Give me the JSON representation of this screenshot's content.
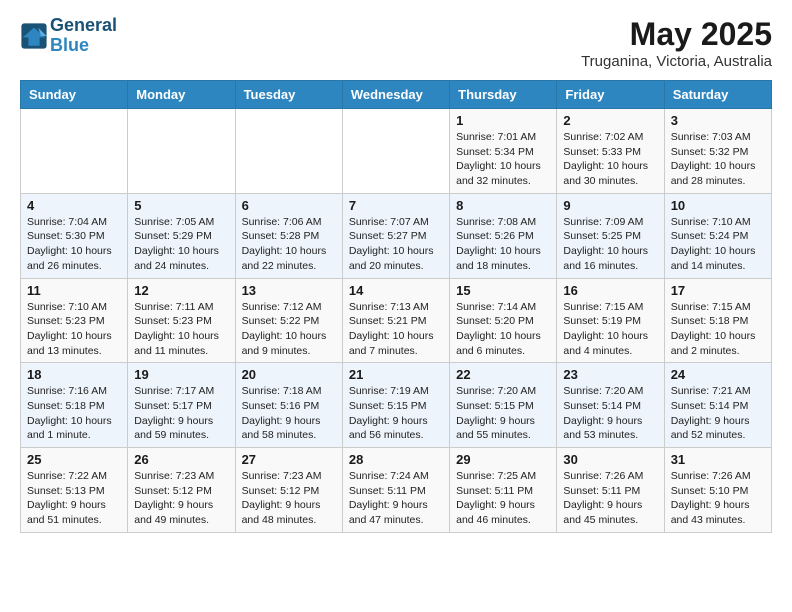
{
  "header": {
    "logo_line1": "General",
    "logo_line2": "Blue",
    "title": "May 2025",
    "subtitle": "Truganina, Victoria, Australia"
  },
  "days_of_week": [
    "Sunday",
    "Monday",
    "Tuesday",
    "Wednesday",
    "Thursday",
    "Friday",
    "Saturday"
  ],
  "weeks": [
    [
      {
        "day": "",
        "text": ""
      },
      {
        "day": "",
        "text": ""
      },
      {
        "day": "",
        "text": ""
      },
      {
        "day": "",
        "text": ""
      },
      {
        "day": "1",
        "text": "Sunrise: 7:01 AM\nSunset: 5:34 PM\nDaylight: 10 hours\nand 32 minutes."
      },
      {
        "day": "2",
        "text": "Sunrise: 7:02 AM\nSunset: 5:33 PM\nDaylight: 10 hours\nand 30 minutes."
      },
      {
        "day": "3",
        "text": "Sunrise: 7:03 AM\nSunset: 5:32 PM\nDaylight: 10 hours\nand 28 minutes."
      }
    ],
    [
      {
        "day": "4",
        "text": "Sunrise: 7:04 AM\nSunset: 5:30 PM\nDaylight: 10 hours\nand 26 minutes."
      },
      {
        "day": "5",
        "text": "Sunrise: 7:05 AM\nSunset: 5:29 PM\nDaylight: 10 hours\nand 24 minutes."
      },
      {
        "day": "6",
        "text": "Sunrise: 7:06 AM\nSunset: 5:28 PM\nDaylight: 10 hours\nand 22 minutes."
      },
      {
        "day": "7",
        "text": "Sunrise: 7:07 AM\nSunset: 5:27 PM\nDaylight: 10 hours\nand 20 minutes."
      },
      {
        "day": "8",
        "text": "Sunrise: 7:08 AM\nSunset: 5:26 PM\nDaylight: 10 hours\nand 18 minutes."
      },
      {
        "day": "9",
        "text": "Sunrise: 7:09 AM\nSunset: 5:25 PM\nDaylight: 10 hours\nand 16 minutes."
      },
      {
        "day": "10",
        "text": "Sunrise: 7:10 AM\nSunset: 5:24 PM\nDaylight: 10 hours\nand 14 minutes."
      }
    ],
    [
      {
        "day": "11",
        "text": "Sunrise: 7:10 AM\nSunset: 5:23 PM\nDaylight: 10 hours\nand 13 minutes."
      },
      {
        "day": "12",
        "text": "Sunrise: 7:11 AM\nSunset: 5:23 PM\nDaylight: 10 hours\nand 11 minutes."
      },
      {
        "day": "13",
        "text": "Sunrise: 7:12 AM\nSunset: 5:22 PM\nDaylight: 10 hours\nand 9 minutes."
      },
      {
        "day": "14",
        "text": "Sunrise: 7:13 AM\nSunset: 5:21 PM\nDaylight: 10 hours\nand 7 minutes."
      },
      {
        "day": "15",
        "text": "Sunrise: 7:14 AM\nSunset: 5:20 PM\nDaylight: 10 hours\nand 6 minutes."
      },
      {
        "day": "16",
        "text": "Sunrise: 7:15 AM\nSunset: 5:19 PM\nDaylight: 10 hours\nand 4 minutes."
      },
      {
        "day": "17",
        "text": "Sunrise: 7:15 AM\nSunset: 5:18 PM\nDaylight: 10 hours\nand 2 minutes."
      }
    ],
    [
      {
        "day": "18",
        "text": "Sunrise: 7:16 AM\nSunset: 5:18 PM\nDaylight: 10 hours\nand 1 minute."
      },
      {
        "day": "19",
        "text": "Sunrise: 7:17 AM\nSunset: 5:17 PM\nDaylight: 9 hours\nand 59 minutes."
      },
      {
        "day": "20",
        "text": "Sunrise: 7:18 AM\nSunset: 5:16 PM\nDaylight: 9 hours\nand 58 minutes."
      },
      {
        "day": "21",
        "text": "Sunrise: 7:19 AM\nSunset: 5:15 PM\nDaylight: 9 hours\nand 56 minutes."
      },
      {
        "day": "22",
        "text": "Sunrise: 7:20 AM\nSunset: 5:15 PM\nDaylight: 9 hours\nand 55 minutes."
      },
      {
        "day": "23",
        "text": "Sunrise: 7:20 AM\nSunset: 5:14 PM\nDaylight: 9 hours\nand 53 minutes."
      },
      {
        "day": "24",
        "text": "Sunrise: 7:21 AM\nSunset: 5:14 PM\nDaylight: 9 hours\nand 52 minutes."
      }
    ],
    [
      {
        "day": "25",
        "text": "Sunrise: 7:22 AM\nSunset: 5:13 PM\nDaylight: 9 hours\nand 51 minutes."
      },
      {
        "day": "26",
        "text": "Sunrise: 7:23 AM\nSunset: 5:12 PM\nDaylight: 9 hours\nand 49 minutes."
      },
      {
        "day": "27",
        "text": "Sunrise: 7:23 AM\nSunset: 5:12 PM\nDaylight: 9 hours\nand 48 minutes."
      },
      {
        "day": "28",
        "text": "Sunrise: 7:24 AM\nSunset: 5:11 PM\nDaylight: 9 hours\nand 47 minutes."
      },
      {
        "day": "29",
        "text": "Sunrise: 7:25 AM\nSunset: 5:11 PM\nDaylight: 9 hours\nand 46 minutes."
      },
      {
        "day": "30",
        "text": "Sunrise: 7:26 AM\nSunset: 5:11 PM\nDaylight: 9 hours\nand 45 minutes."
      },
      {
        "day": "31",
        "text": "Sunrise: 7:26 AM\nSunset: 5:10 PM\nDaylight: 9 hours\nand 43 minutes."
      }
    ]
  ]
}
